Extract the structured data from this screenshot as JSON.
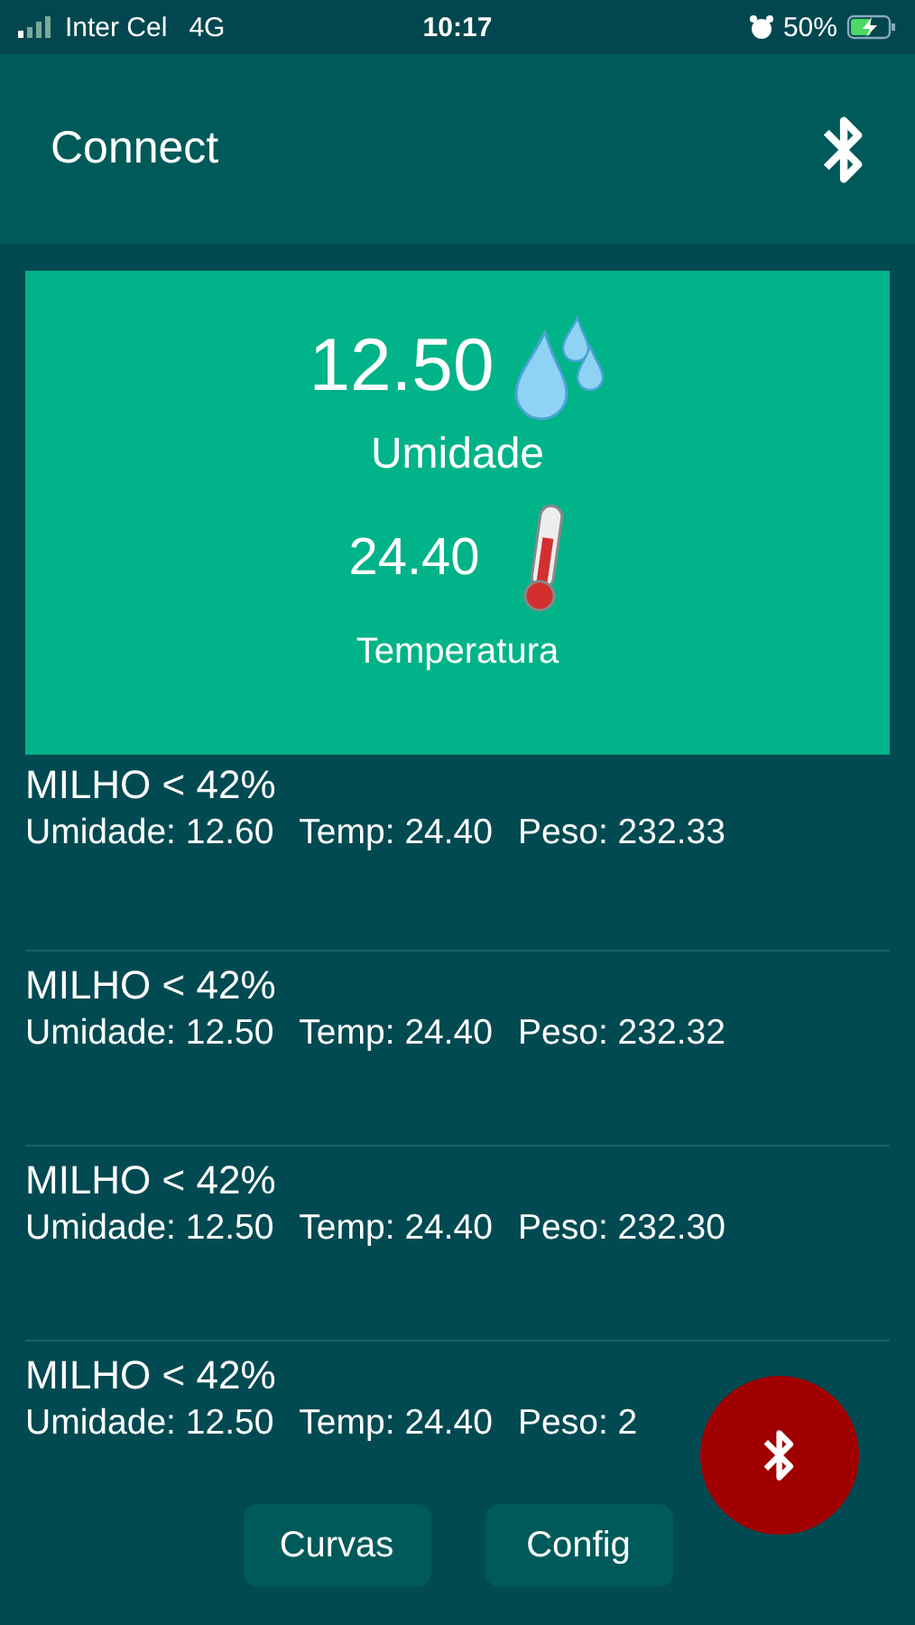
{
  "status_bar": {
    "carrier": "Inter Cel",
    "network": "4G",
    "time": "10:17",
    "battery": "50%"
  },
  "header": {
    "title": "Connect"
  },
  "summary": {
    "humidity_value": "12.50",
    "humidity_label": "Umidade",
    "temperature_value": "24.40",
    "temperature_label": "Temperatura"
  },
  "readings": [
    {
      "title": "MILHO < 42%",
      "humidity": "Umidade: 12.60",
      "temp": "Temp: 24.40",
      "weight": "Peso: 232.33"
    },
    {
      "title": "MILHO < 42%",
      "humidity": "Umidade: 12.50",
      "temp": "Temp: 24.40",
      "weight": "Peso: 232.32"
    },
    {
      "title": "MILHO < 42%",
      "humidity": "Umidade: 12.50",
      "temp": "Temp: 24.40",
      "weight": "Peso: 232.30"
    },
    {
      "title": "MILHO < 42%",
      "humidity": "Umidade: 12.50",
      "temp": "Temp: 24.40",
      "weight": "Peso: 2"
    }
  ],
  "buttons": [
    "Curvas",
    "Config"
  ]
}
